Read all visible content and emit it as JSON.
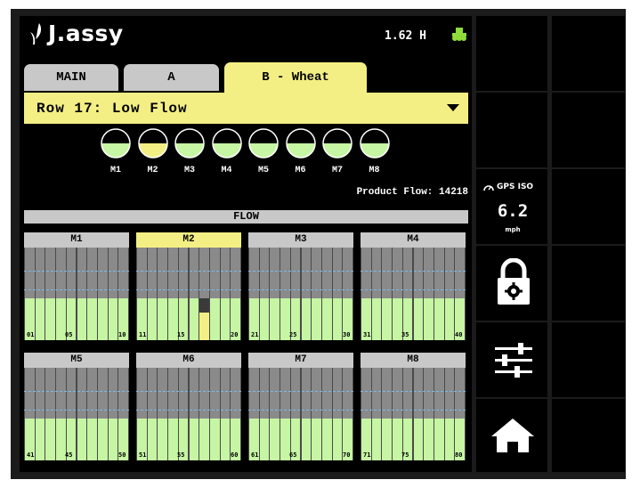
{
  "header": {
    "logo_text": "J.assy",
    "hours": "1.62 H",
    "tractor_icon": "tractor-icon"
  },
  "tabs": [
    {
      "label": "MAIN",
      "active": false
    },
    {
      "label": "A",
      "active": false
    },
    {
      "label": "B - Wheat",
      "active": true
    }
  ],
  "row_select": {
    "value": "Row 17: Low Flow"
  },
  "meters": [
    {
      "label": "M1",
      "fill": 0.5
    },
    {
      "label": "M2",
      "fill": 0.5,
      "highlight": true
    },
    {
      "label": "M3",
      "fill": 0.5
    },
    {
      "label": "M4",
      "fill": 0.5
    },
    {
      "label": "M5",
      "fill": 0.5
    },
    {
      "label": "M6",
      "fill": 0.5
    },
    {
      "label": "M7",
      "fill": 0.5
    },
    {
      "label": "M8",
      "fill": 0.5
    }
  ],
  "product_flow": "Product Flow: 14218",
  "flow_section_title": "FLOW",
  "flow_panels": [
    {
      "name": "M1",
      "ticks": [
        "01",
        "05",
        "10"
      ],
      "selected": false
    },
    {
      "name": "M2",
      "ticks": [
        "11",
        "15",
        "20"
      ],
      "selected": true
    },
    {
      "name": "M3",
      "ticks": [
        "21",
        "25",
        "30"
      ],
      "selected": false
    },
    {
      "name": "M4",
      "ticks": [
        "31",
        "35",
        "40"
      ],
      "selected": false
    },
    {
      "name": "M5",
      "ticks": [
        "41",
        "45",
        "50"
      ],
      "selected": false
    },
    {
      "name": "M6",
      "ticks": [
        "51",
        "55",
        "60"
      ],
      "selected": false
    },
    {
      "name": "M7",
      "ticks": [
        "61",
        "65",
        "70"
      ],
      "selected": false
    },
    {
      "name": "M8",
      "ticks": [
        "71",
        "75",
        "80"
      ],
      "selected": false
    }
  ],
  "flow_levels": {
    "normal": 0.45,
    "row_17_low": 0.3
  },
  "speed": {
    "source": "GPS ISO",
    "value": "6.2",
    "unit": "mph"
  },
  "side_buttons": [
    {
      "icon": "lock-settings-icon"
    },
    {
      "icon": "sliders-icon"
    },
    {
      "icon": "home-icon"
    }
  ],
  "colors": {
    "accent_yellow": "#f4ef84",
    "flow_green": "#c6f5a3",
    "tab_gray": "#c8c8c8",
    "background": "#000000"
  }
}
